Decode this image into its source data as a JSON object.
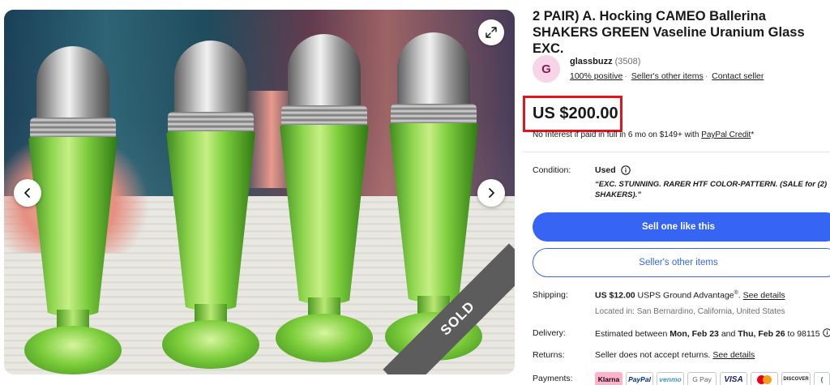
{
  "listing": {
    "title": "2 PAIR) A. Hocking CAMEO Ballerina SHAKERS GREEN Vaseline Uranium Glass EXC.",
    "image_badge": "SOLD"
  },
  "seller": {
    "avatar_initial": "G",
    "name": "glassbuzz",
    "feedback_count": "(3508)",
    "positive": "100% positive",
    "other_items_link": "Seller's other items",
    "contact_link": "Contact seller"
  },
  "price": {
    "amount": "US $200.00",
    "finance_text": "No Interest if paid in full in 6 mo on $149+ with",
    "finance_link": "PayPal Credit",
    "finance_suffix": "*",
    "highlight_color": "#e0161d"
  },
  "condition": {
    "label": "Condition:",
    "value": "Used",
    "description_line1": "“EXC. STUNNING. RARER HTF COLOR-PATTERN. (SALE for (2)",
    "description_line2": "SHAKERS).”"
  },
  "buttons": {
    "sell_one_like_this": "Sell one like this",
    "sellers_other_items": "Seller's other items",
    "primary_color": "#3665f3"
  },
  "shipping": {
    "label": "Shipping:",
    "price": "US $12.00",
    "service": " USPS Ground Advantage",
    "registered": "®",
    "period": ".",
    "details_link": "See details",
    "location": "Located in: San Bernardino, California, United States"
  },
  "delivery": {
    "label": "Delivery:",
    "prefix": "Estimated between ",
    "date_start": "Mon, Feb 23",
    "middle": " and ",
    "date_end": "Thu, Feb 26",
    "suffix": " to 98115"
  },
  "returns": {
    "label": "Returns:",
    "text": "Seller does not accept returns. ",
    "details_link": "See details"
  },
  "payments": {
    "label": "Payments:",
    "methods": [
      "Klarna",
      "PayPal",
      "venmo",
      "G Pay",
      "VISA",
      "mastercard",
      "DISCOVER",
      "amex"
    ]
  },
  "icons": {
    "prev": "chevron-left-icon",
    "next": "chevron-right-icon",
    "expand": "expand-icon",
    "info": "info-icon"
  }
}
